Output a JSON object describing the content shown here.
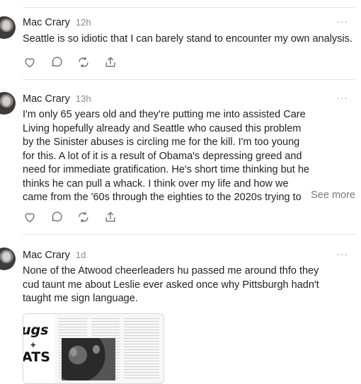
{
  "posts": [
    {
      "author": "Mac Crary",
      "time": "12h",
      "more": "···",
      "text": "Seattle is so idiotic that I can barely stand to encounter my own analysis."
    },
    {
      "author": "Mac Crary",
      "time": "13h",
      "more": "···",
      "text": "I'm only 65 years old and they're putting me into assisted Care Living hopefully already and Seattle who caused this problem by the Sinister abuses is circling me for the kill. I'm too young for this. A lot of it is a result of Obama's depressing greed and need for immediate gratification. He's short time thinking but he thinks he can pull a whack. I think over my life and how we came from the '60s through the eighties to the 2020s trying to make sense of it both from the point of view what was...",
      "see_more": "See more"
    },
    {
      "author": "Mac Crary",
      "time": "1d",
      "more": "···",
      "text": "None of the Atwood cheerleaders hu passed me around thfo they cud taunt me about Leslie ever asked once why Pittsburgh hadn't taught me sign language.",
      "image_text": {
        "word1": "ugs",
        "plus": "+",
        "word2": "ATS"
      }
    }
  ],
  "icons": [
    "heart-icon",
    "comment-icon",
    "repost-icon",
    "share-icon"
  ],
  "colors": {
    "text": "#222222",
    "muted": "#8a8a8a",
    "divider": "#e6e6e6",
    "icon": "#6b6b6b"
  }
}
